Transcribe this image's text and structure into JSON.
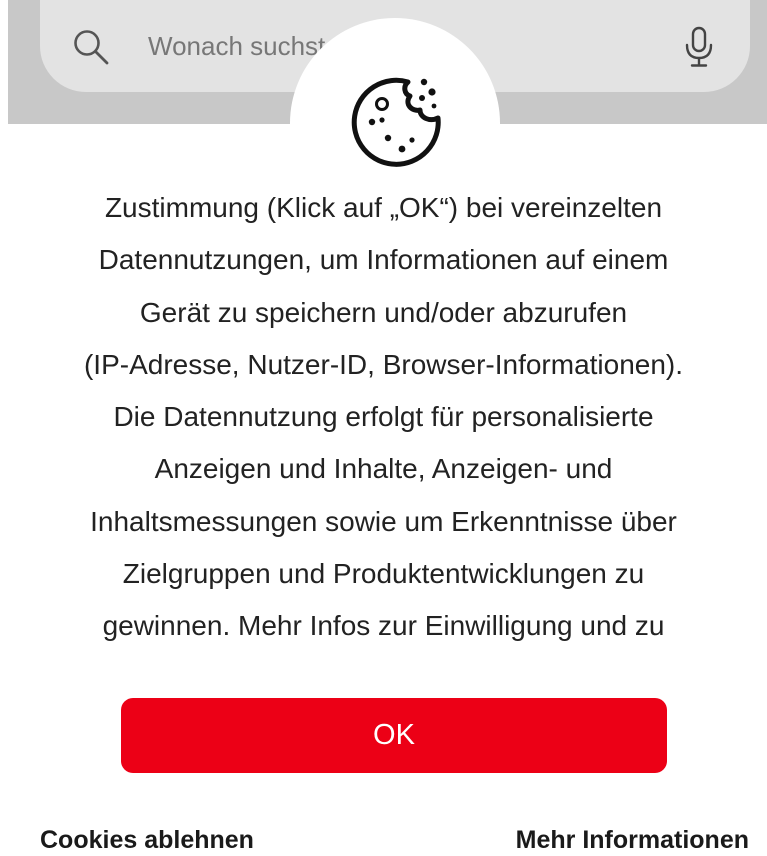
{
  "search": {
    "placeholder": "Wonach suchst"
  },
  "consent": {
    "lines": [
      "Zustimmung (Klick auf „OK“) bei vereinzelten",
      "Datennutzungen, um Informationen auf einem",
      "Gerät zu speichern und/oder abzurufen",
      "(IP-Adresse, Nutzer-ID, Browser-Informationen).",
      "Die Datennutzung erfolgt für personalisierte",
      "Anzeigen und Inhalte, Anzeigen- und",
      "Inhaltsmessungen sowie um Erkenntnisse über",
      "Zielgruppen und Produktentwicklungen zu",
      "gewinnen. Mehr Infos zur Einwilligung und zu"
    ]
  },
  "buttons": {
    "ok_label": "OK",
    "reject_label": "Cookies ablehnen",
    "more_info_label": "Mehr Informationen"
  },
  "icons": {
    "search": "search-icon",
    "microphone": "microphone-icon",
    "cookie": "cookie-icon"
  },
  "colors": {
    "accent": "#ec0016",
    "search_band": "#c8c8c8",
    "search_field": "#e3e3e3",
    "text": "#222222"
  }
}
